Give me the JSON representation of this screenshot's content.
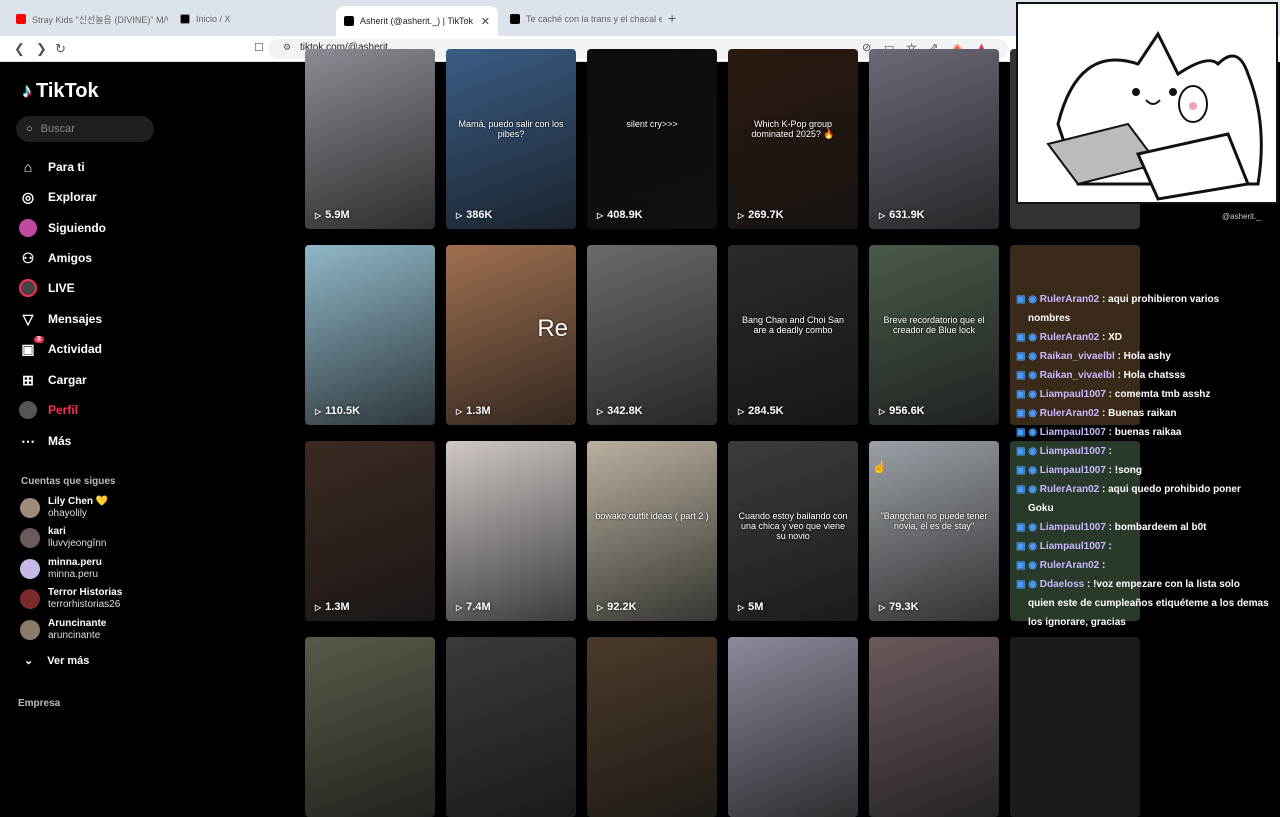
{
  "browser": {
    "tabs": [
      {
        "title": "Stray Kids \"신선놀음 (DIVINE)\" M/V",
        "color": "#ff0000"
      },
      {
        "title": "Inicio / X",
        "color": "#000000"
      },
      {
        "title": "Asherit (@asherit._) | TikTok",
        "color": "#000000"
      },
      {
        "title": "Te caché con la trans y el chacal en K",
        "color": "#000000"
      }
    ],
    "url": "tiktok.com/@asherit._"
  },
  "sidebar": {
    "brand": "TikTok",
    "search_placeholder": "Buscar",
    "nav": [
      {
        "label": "Para ti",
        "icon": "home-icon"
      },
      {
        "label": "Explorar",
        "icon": "compass-icon"
      },
      {
        "label": "Siguiendo",
        "icon": "following-icon"
      },
      {
        "label": "Amigos",
        "icon": "friends-icon"
      },
      {
        "label": "LIVE",
        "icon": "live-icon"
      },
      {
        "label": "Mensajes",
        "icon": "send-icon"
      },
      {
        "label": "Actividad",
        "icon": "activity-icon",
        "badge": "8"
      },
      {
        "label": "Cargar",
        "icon": "upload-icon"
      },
      {
        "label": "Perfil",
        "icon": "profile-icon"
      },
      {
        "label": "Más",
        "icon": "more-icon"
      }
    ],
    "following_title": "Cuentas que sigues",
    "accounts": [
      {
        "name": "Lily Chen 💛",
        "handle": "ohayolily"
      },
      {
        "name": "kari",
        "handle": "lluvvjeongînn"
      },
      {
        "name": "minna.peru",
        "handle": "minna.peru"
      },
      {
        "name": "Terror Historias",
        "handle": "terrorhistorias26"
      },
      {
        "name": "Aruncinante",
        "handle": "aruncinante"
      }
    ],
    "see_more": "Ver más",
    "footer": "Empresa"
  },
  "videos": [
    {
      "views": "5.9M",
      "bg": "#8d8a93"
    },
    {
      "views": "386K",
      "bg": "#3a5d86",
      "caption": "Mamá, puedo salir con los pibes?"
    },
    {
      "views": "408.9K",
      "bg": "#0c0c0c",
      "caption": "silent cry>>>"
    },
    {
      "views": "269.7K",
      "bg": "#2a1a10",
      "caption": "Which K-Pop group dominated 2025? 🔥"
    },
    {
      "views": "631.9K",
      "bg": "#6d6a78"
    },
    {
      "views": "110.5K",
      "bg": "#8fb7c7"
    },
    {
      "views": "1.3M",
      "bg": "#a07050",
      "caption": "Re"
    },
    {
      "views": "342.8K",
      "bg": "#6b6b6b"
    },
    {
      "views": "284.5K",
      "bg": "#2a2a2a",
      "caption": "Bang Chan and Choi San are a deadly combo"
    },
    {
      "views": "956.6K",
      "bg": "#4a5a4a",
      "caption": "Breve recordatorio que el creador de Blue lock"
    },
    {
      "views": "1.3M",
      "bg": "#3a2a22"
    },
    {
      "views": "7.4M",
      "bg": "#cfc8c4"
    },
    {
      "views": "92.2K",
      "bg": "#b8b0a0",
      "caption": "bowako outfit ideas ( part 2 )"
    },
    {
      "views": "5M",
      "bg": "#3c3c3c",
      "caption": "Cuando estoy bailando con una chica y veo que viene su novio"
    },
    {
      "views": "79.3K",
      "bg": "#9aa0a6",
      "caption": "\"Bangchan no puede tener novia, él es de stay\""
    },
    {
      "views": "",
      "bg": "#5a5a4a"
    },
    {
      "views": "",
      "bg": "#3a3a3a"
    },
    {
      "views": "",
      "bg": "#4a3a2a"
    },
    {
      "views": "",
      "bg": "#8a8a9a"
    },
    {
      "views": "",
      "bg": "#6a5a5a"
    }
  ],
  "stream": {
    "handle": "@asherit._",
    "chat": [
      {
        "user": "RulerAran02",
        "msg": ": aqui prohibieron varios"
      },
      {
        "user": "",
        "msg": "nombres"
      },
      {
        "user": "RulerAran02",
        "msg": ": XD"
      },
      {
        "user": "Raikan_vivaelbl",
        "msg": ": Hola ashy"
      },
      {
        "user": "Raikan_vivaelbl",
        "msg": ": Hola chatsss"
      },
      {
        "user": "Liampaul1007",
        "msg": ": comemta tmb asshz"
      },
      {
        "user": "RulerAran02",
        "msg": ": Buenas raikan"
      },
      {
        "user": "Liampaul1007",
        "msg": ": buenas raikaa"
      },
      {
        "user": "Liampaul1007",
        "msg": ":"
      },
      {
        "user": "Liampaul1007",
        "msg": ": !song"
      },
      {
        "user": "RulerAran02",
        "msg": ": aqui quedo prohibido poner"
      },
      {
        "user": "",
        "msg": "Goku"
      },
      {
        "user": "Liampaul1007",
        "msg": ": bombardeem al b0t"
      },
      {
        "user": "Liampaul1007",
        "msg": ":"
      },
      {
        "user": "RulerAran02",
        "msg": ":"
      },
      {
        "user": "Ddaeloss",
        "msg": ": !voz empezare con la lista solo"
      },
      {
        "user": "",
        "msg": "quien este de cumpleaños etiquéteme a los demas"
      },
      {
        "user": "",
        "msg": "los ignorare, gracias"
      }
    ]
  }
}
